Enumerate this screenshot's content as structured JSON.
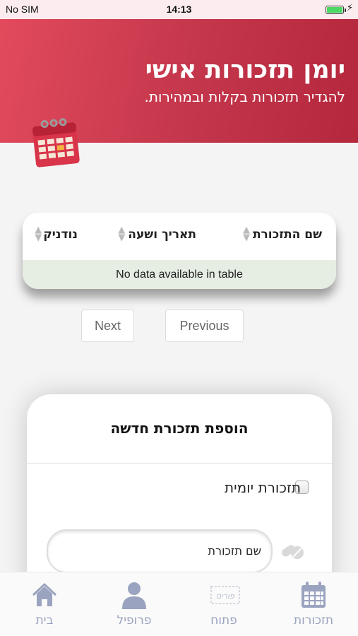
{
  "status_bar": {
    "carrier": "No SIM",
    "time": "14:13",
    "battery_level": 1.0
  },
  "header": {
    "title": "יומן תזכורות אישי",
    "subtitle": "להגדיר תזכורות בקלות ובמהירות."
  },
  "table": {
    "columns": [
      "שם התזכורת",
      "תאריך ושעה",
      "נודניק"
    ],
    "empty_message": "No data available in table"
  },
  "pager": {
    "next_label": "Next",
    "previous_label": "Previous"
  },
  "add_reminder": {
    "title": "הוספת תזכורת חדשה",
    "daily_label": "תזכורת יומית",
    "daily_checked": false,
    "name_value": "שם תזכורת"
  },
  "tabbar": {
    "items": [
      {
        "label": "בית",
        "icon": "home-icon"
      },
      {
        "label": "פרופיל",
        "icon": "profile-icon"
      },
      {
        "label": "פתוח",
        "icon": "open-icon",
        "icon_text": "פורים"
      },
      {
        "label": "תזכורות",
        "icon": "calendar-icon"
      }
    ]
  },
  "colors": {
    "accent": "#c93a4f",
    "tab_icon": "#9aa3bf"
  }
}
